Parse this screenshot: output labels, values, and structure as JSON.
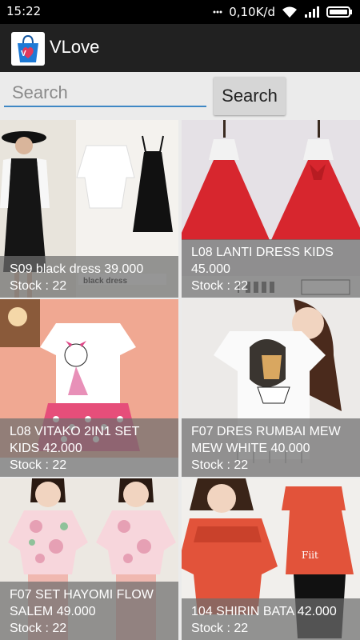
{
  "status_bar": {
    "time": "15:22",
    "speed": "0,10K/d",
    "icons": [
      "dots-icon",
      "wifi-icon",
      "signal-icon",
      "battery-icon"
    ]
  },
  "app": {
    "title": "VLove",
    "logo_icon": "shopping-bag-heart-logo"
  },
  "search": {
    "placeholder": "Search",
    "value": "",
    "button_label": "Search"
  },
  "colors": {
    "status_bar": "#000000",
    "app_bar": "#212121",
    "background": "#ebebeb",
    "input_underline": "#3f88c5",
    "caption_overlay": "#6e6e6e"
  },
  "products": [
    {
      "name": "S09 black dress 39.000",
      "stock": "Stock : 22"
    },
    {
      "name": "L08 LANTI DRESS KIDS 45.000",
      "stock": "Stock : 22"
    },
    {
      "name": "L08 VITAKO 2IN1 SET KIDS 42.000",
      "stock": "Stock : 22"
    },
    {
      "name": "F07 DRES RUMBAI MEW MEW WHITE 40.000",
      "stock": "Stock : 22"
    },
    {
      "name": "F07 SET HAYOMI FLOW SALEM  49.000",
      "stock": "Stock : 22"
    },
    {
      "name": "104 SHIRIN BATA 42.000",
      "stock": "Stock : 22"
    }
  ]
}
